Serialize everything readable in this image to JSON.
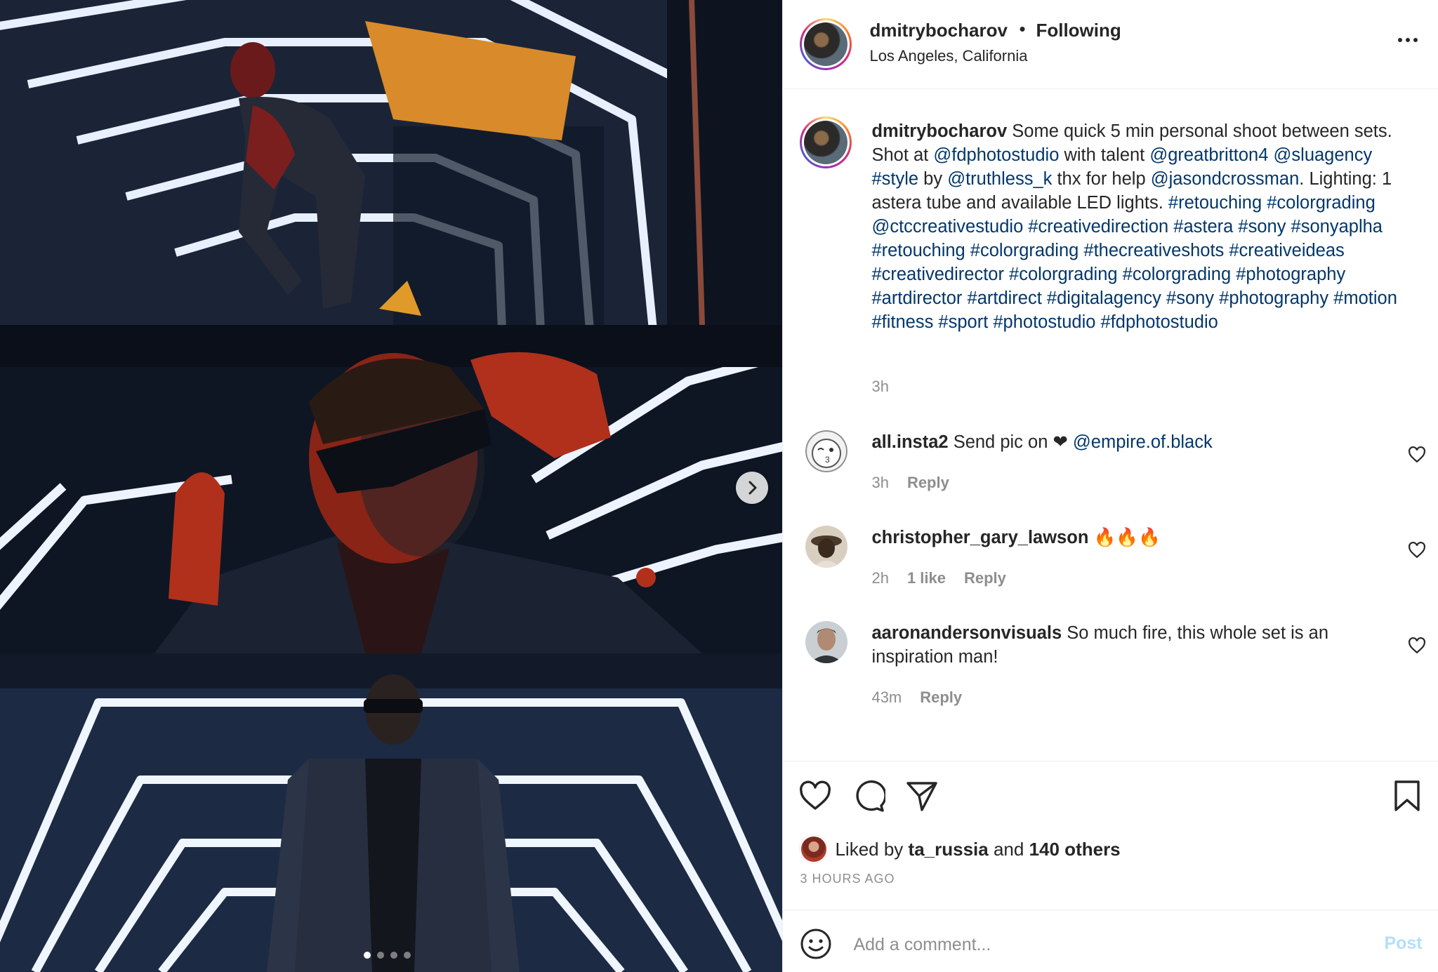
{
  "header": {
    "username": "dmitrybocharov",
    "separator": "•",
    "follow_status": "Following",
    "location": "Los Angeles, California"
  },
  "caption": {
    "username": "dmitrybocharov",
    "segments": [
      {
        "t": "Some quick 5 min personal shoot between sets. Shot at ",
        "link": false
      },
      {
        "t": "@fdphotostudio",
        "link": true
      },
      {
        "t": " with talent ",
        "link": false
      },
      {
        "t": "@greatbritton4",
        "link": true
      },
      {
        "t": " ",
        "link": false
      },
      {
        "t": "@sluagency",
        "link": true
      },
      {
        "t": " ",
        "link": false
      },
      {
        "t": "#style",
        "link": true
      },
      {
        "t": " by ",
        "link": false
      },
      {
        "t": "@truthless_k",
        "link": true
      },
      {
        "t": " thx for help ",
        "link": false
      },
      {
        "t": "@jasondcrossman",
        "link": true
      },
      {
        "t": ". Lighting: 1 astera tube and available LED lights. ",
        "link": false
      },
      {
        "t": "#retouching #colorgrading @ctccreativestudio #creativedirection #astera #sony #sonyaplha #retouching #colorgrading #thecreativeshots #creativeideas #creativedirector #colorgrading #colorgrading #photography #artdirector #artdirect #digitalagency #sony #photography #motion #fitness #sport #photostudio #fdphotostudio",
        "link": true
      }
    ],
    "time": "3h"
  },
  "comments": [
    {
      "username": "all.insta2",
      "text": "Send pic on ❤ ",
      "mention": "@empire.of.black",
      "time": "3h",
      "likes": "",
      "reply": "Reply"
    },
    {
      "username": "christopher_gary_lawson",
      "text": "🔥🔥🔥",
      "mention": "",
      "time": "2h",
      "likes": "1 like",
      "reply": "Reply"
    },
    {
      "username": "aaronandersonvisuals",
      "text": "So much fire, this whole set is an inspiration man!",
      "mention": "",
      "time": "43m",
      "likes": "",
      "reply": "Reply"
    }
  ],
  "likes": {
    "prefix": "Liked by",
    "user": "ta_russia",
    "and": "and",
    "others": "140 others"
  },
  "timestamp": "3 HOURS AGO",
  "add_comment": {
    "placeholder": "Add a comment...",
    "post_label": "Post"
  },
  "carousel": {
    "slide_count": 4,
    "active_index": 0
  },
  "icons": {
    "like": "heart-icon",
    "comment": "speech-bubble-icon",
    "share": "paper-plane-icon",
    "save": "bookmark-icon",
    "emoji": "smiley-icon",
    "next": "chevron-right-icon",
    "more": "more-options-icon"
  },
  "colors": {
    "link": "#00376b",
    "muted": "#8e8e8e",
    "post_disabled": "#b2dffc"
  }
}
